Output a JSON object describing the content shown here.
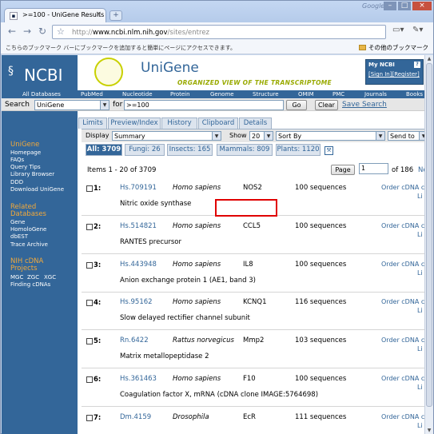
{
  "browser": {
    "tab_title": ">=100 - UniGene Results",
    "new_tab": "+",
    "brand": "Google",
    "url_host": "www.ncbi.nlm.nih.gov",
    "url_path": "/sites/entrez",
    "url_scheme": "http://",
    "bookmark_msg": "こちらのブックマーク バーにブックマークを追加すると簡単にページにアクセスできます。",
    "other_bookmarks": "その他のブックマーク"
  },
  "header": {
    "ncbi": "NCBI",
    "unigene": "UniGene",
    "tagline": "ORGANIZED VIEW OF THE TRANSCRIPTOME",
    "myncbi_title": "My NCBI",
    "myncbi_help": "?",
    "sign_in": "[Sign In]",
    "register": "[Register]"
  },
  "dbnav": [
    "All Databases",
    "PubMed",
    "Nucleotide",
    "Protein",
    "Genome",
    "Structure",
    "OMIM",
    "PMC",
    "Journals",
    "Books"
  ],
  "search": {
    "label": "Search",
    "db": "UniGene",
    "for": "for",
    "query": ">=100",
    "go": "Go",
    "clear": "Clear",
    "save": "Save Search"
  },
  "subtabs": [
    "Limits",
    "Preview/Index",
    "History",
    "Clipboard",
    "Details"
  ],
  "leftnav": {
    "sec1": "UniGene",
    "sec1_items": [
      "Homepage",
      "FAQs",
      "Query Tips",
      "Library Browser",
      "DDD",
      "Download UniGene"
    ],
    "sec2a": "Related",
    "sec2b": "Databases",
    "sec2_items": [
      "Gene",
      "HomoloGene",
      "dbEST",
      "Trace Archive"
    ],
    "sec3a": "NIH cDNA",
    "sec3b": "Projects",
    "mgc": "MGC",
    "zgc": "ZGC",
    "xgc": "XGC",
    "finding": "Finding cDNAs"
  },
  "display": {
    "label": "Display",
    "format": "Summary",
    "show": "Show",
    "count": "20",
    "sort": "Sort By",
    "send": "Send to"
  },
  "filters": [
    {
      "label": "All: 3709"
    },
    {
      "label": "Fungi: 26"
    },
    {
      "label": "Insects: 165"
    },
    {
      "label": "Mammals: 809"
    },
    {
      "label": "Plants: 1120"
    }
  ],
  "paging": {
    "items": "Items 1 - 20 of 3709",
    "page_btn": "Page",
    "page_value": "1",
    "of": "of 186",
    "next": "Ne"
  },
  "results": [
    {
      "num": "1:",
      "acc": "Hs.709191",
      "org": "Homo sapiens",
      "gene": "NOS2",
      "seqs": "100 sequences",
      "order": "Order cDNA clo",
      "li": "Li",
      "desc": "Nitric oxide synthase"
    },
    {
      "num": "2:",
      "acc": "Hs.514821",
      "org": "Homo sapiens",
      "gene": "CCL5",
      "seqs": "100 sequences",
      "order": "Order cDNA clo",
      "li": "Li",
      "desc": "RANTES precursor"
    },
    {
      "num": "3:",
      "acc": "Hs.443948",
      "org": "Homo sapiens",
      "gene": "IL8",
      "seqs": "100 sequences",
      "order": "Order cDNA clo",
      "li": "Li",
      "desc": "Anion exchange protein 1 (AE1, band 3)"
    },
    {
      "num": "4:",
      "acc": "Hs.95162",
      "org": "Homo sapiens",
      "gene": "KCNQ1",
      "seqs": "116 sequences",
      "order": "Order cDNA clo",
      "li": "Li",
      "desc": "Slow delayed rectifier channel subunit"
    },
    {
      "num": "5:",
      "acc": "Rn.6422",
      "org": "Rattus norvegicus",
      "gene": "Mmp2",
      "seqs": "103 sequences",
      "order": "Order cDNA clo",
      "li": "Li",
      "desc": "Matrix metallopeptidase 2"
    },
    {
      "num": "6:",
      "acc": "Hs.361463",
      "org": "Homo sapiens",
      "gene": "F10",
      "seqs": "100 sequences",
      "order": "Order cDNA clo",
      "li": "Li",
      "desc": "Coagulation factor X, mRNA (cDNA clone IMAGE:5764698)"
    },
    {
      "num": "7:",
      "acc": "Dm.4159",
      "org": "Drosophila",
      "gene": "EcR",
      "seqs": "111 sequences",
      "order": "Order cDNA clo",
      "li": "Li",
      "desc": ""
    }
  ],
  "colors": {
    "ncbi_blue": "#336699",
    "accent_orange": "#f2a93b",
    "highlight_red": "#e00000"
  }
}
